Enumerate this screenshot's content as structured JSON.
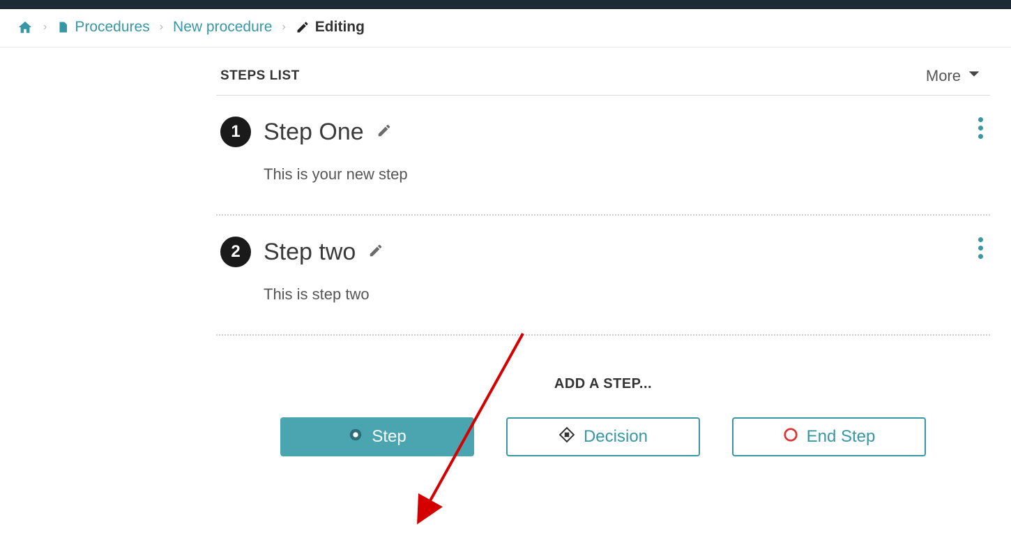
{
  "breadcrumb": {
    "procedures_label": "Procedures",
    "new_procedure_label": "New procedure",
    "editing_label": "Editing"
  },
  "list": {
    "title": "STEPS LIST",
    "more_label": "More"
  },
  "steps": [
    {
      "number": "1",
      "title": "Step One",
      "description": "This is your new step"
    },
    {
      "number": "2",
      "title": "Step two",
      "description": "This is step two"
    }
  ],
  "add": {
    "heading": "ADD A STEP...",
    "step_label": "Step",
    "decision_label": "Decision",
    "end_label": "End Step"
  }
}
